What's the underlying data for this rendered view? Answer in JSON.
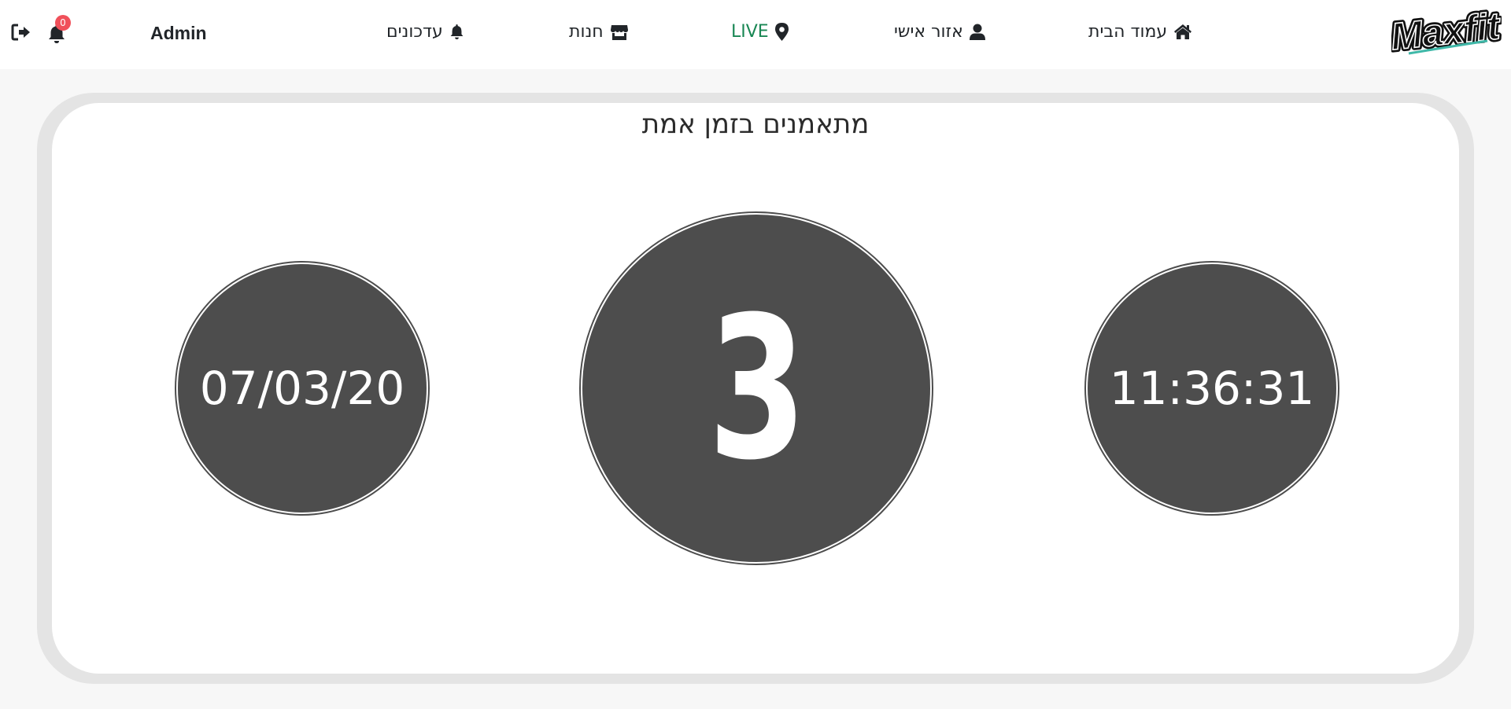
{
  "header": {
    "logo": "Maxfit",
    "nav": {
      "home": "עמוד הבית",
      "personal": "אזור אישי",
      "live": "LIVE",
      "store": "חנות",
      "updates": "עדכונים"
    },
    "user": "Admin",
    "notifications_count": "0"
  },
  "main": {
    "title": "מתאמנים בזמן אמת",
    "date": "07/03/20",
    "live_count": "3",
    "time": "11:36:31"
  },
  "colors": {
    "circle": "#4d4d4d",
    "live": "#198754",
    "badge": "#f0505a",
    "card_border": "#e4e4e4"
  },
  "icons": [
    "logout-icon",
    "bell-icon",
    "home-icon",
    "user-icon",
    "map-marker-icon",
    "store-icon"
  ]
}
